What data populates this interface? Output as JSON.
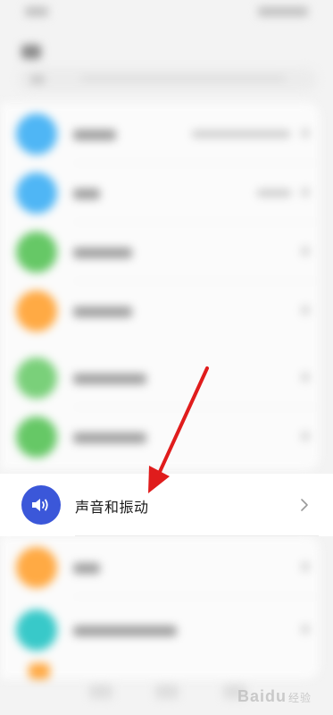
{
  "highlight_item": {
    "label": "声音和振动",
    "icon": "speaker-icon",
    "icon_color": "#3b57d9"
  },
  "watermark": {
    "brand": "Bai",
    "suffix": "du",
    "sub": "经验"
  },
  "blurred_icon_colors": [
    "#4fb6f5",
    "#4fb6f5",
    "#66c866",
    "#ffaa44",
    "#7ad07a",
    "#66c866",
    "#ffaa44",
    "#38c9c9"
  ],
  "annotation_arrow_color": "#e01c1c"
}
